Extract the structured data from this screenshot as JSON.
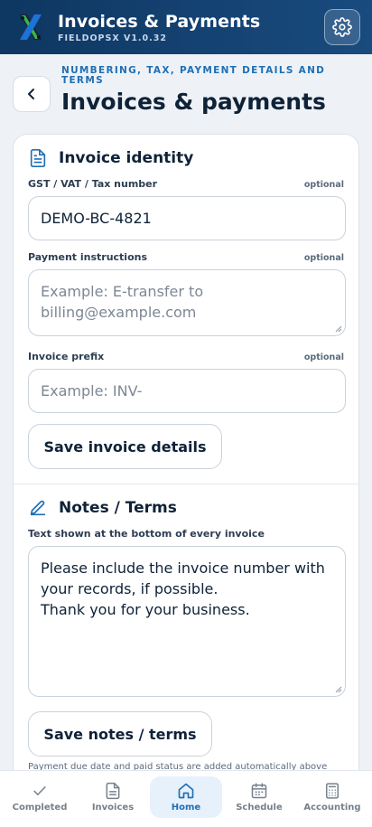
{
  "app": {
    "title": "Invoices & Payments",
    "version": "FIELDOPSX V1.0.32"
  },
  "header": {
    "eyebrow": "NUMBERING, TAX, PAYMENT DETAILS AND TERMS",
    "title": "Invoices & payments"
  },
  "identity": {
    "title": "Invoice identity",
    "tax_label": "GST / VAT / Tax number",
    "tax_optional": "optional",
    "tax_value": "DEMO-BC-4821",
    "payment_label": "Payment instructions",
    "payment_optional": "optional",
    "payment_placeholder": "Example: E-transfer to billing@example.com",
    "prefix_label": "Invoice prefix",
    "prefix_optional": "optional",
    "prefix_placeholder": "Example: INV-",
    "save_label": "Save invoice details"
  },
  "terms": {
    "title": "Notes / Terms",
    "label": "Text shown at the bottom of every invoice",
    "line1": "Please include the invoice number with your records, if possible.",
    "line2": "Thank you for your business.",
    "save_label": "Save notes / terms",
    "footnote": "Payment due date and paid status are added automatically above"
  },
  "nav": {
    "items": [
      {
        "label": "Completed",
        "icon": "check-icon"
      },
      {
        "label": "Invoices",
        "icon": "document-icon"
      },
      {
        "label": "Home",
        "icon": "home-icon",
        "active": true
      },
      {
        "label": "Schedule",
        "icon": "calendar-icon"
      },
      {
        "label": "Accounting",
        "icon": "calculator-icon"
      }
    ]
  },
  "colors": {
    "appbar": "#0e3761",
    "accent": "#1f6fb4",
    "active_nav_bg": "#e7f1fb"
  }
}
